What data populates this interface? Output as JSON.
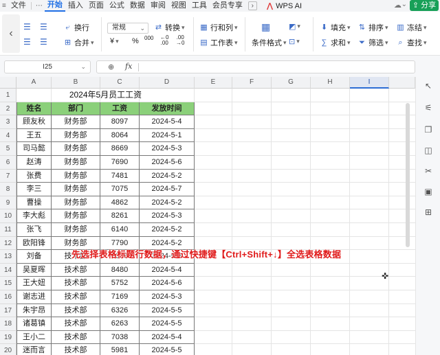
{
  "menu": {
    "items": [
      "文件",
      "开始",
      "插入",
      "页面",
      "公式",
      "数据",
      "审阅",
      "视图",
      "工具",
      "会员专享"
    ],
    "active": "开始",
    "wps_ai": "WPS AI",
    "share": "分享"
  },
  "ribbon": {
    "wrap_label": "换行",
    "merge_label": "合并",
    "font_select": "常规",
    "convert_label": "转换",
    "yen_symbol": "¥",
    "percent_symbol": "%",
    "rowcol_label": "行和列",
    "worksheet_label": "工作表",
    "conditional_format_label": "条件格式",
    "fill_label": "填充",
    "sum_label": "求和",
    "sort_label": "排序",
    "filter_label": "筛选",
    "freeze_label": "冻结",
    "find_label": "查找"
  },
  "formula_bar": {
    "cell_ref": "I25",
    "fx_symbol": "fx",
    "formula": ""
  },
  "grid": {
    "columns": [
      "A",
      "B",
      "C",
      "D",
      "E",
      "F",
      "G",
      "H",
      "I"
    ],
    "selected_column": "I",
    "row_numbers": [
      "1",
      "2",
      "3",
      "4",
      "5",
      "6",
      "7",
      "8",
      "9",
      "10",
      "11",
      "12",
      "13",
      "14",
      "15",
      "16",
      "17",
      "18",
      "19",
      "20"
    ],
    "title": "2024年5月员工工资",
    "headers": [
      "姓名",
      "部门",
      "工资",
      "发放时间"
    ],
    "rows": [
      [
        "顾友秋",
        "财务部",
        "8097",
        "2024-5-4"
      ],
      [
        "王五",
        "财务部",
        "8064",
        "2024-5-1"
      ],
      [
        "司马懿",
        "财务部",
        "8669",
        "2024-5-3"
      ],
      [
        "赵涛",
        "财务部",
        "7690",
        "2024-5-6"
      ],
      [
        "张费",
        "财务部",
        "7481",
        "2024-5-2"
      ],
      [
        "李三",
        "财务部",
        "7075",
        "2024-5-7"
      ],
      [
        "曹操",
        "财务部",
        "4862",
        "2024-5-2"
      ],
      [
        "李大彪",
        "财务部",
        "8261",
        "2024-5-3"
      ],
      [
        "张飞",
        "财务部",
        "6140",
        "2024-5-2"
      ],
      [
        "欧阳锋",
        "财务部",
        "7790",
        "2024-5-2"
      ],
      [
        "刘备",
        "技术部",
        "7338",
        "2024-5-3"
      ],
      [
        "吴夏晖",
        "技术部",
        "8480",
        "2024-5-4"
      ],
      [
        "王大妞",
        "技术部",
        "5752",
        "2024-5-6"
      ],
      [
        "谢志进",
        "技术部",
        "7169",
        "2024-5-3"
      ],
      [
        "朱宇昂",
        "技术部",
        "6326",
        "2024-5-5"
      ],
      [
        "诸葛镇",
        "技术部",
        "6263",
        "2024-5-5"
      ],
      [
        "王小二",
        "技术部",
        "7038",
        "2024-5-4"
      ],
      [
        "迷而言",
        "技术部",
        "5981",
        "2024-5-5"
      ]
    ]
  },
  "caption": "先选择表格标题行数据，通过快捷键【Ctrl+Shift+↓】全选表格数据"
}
